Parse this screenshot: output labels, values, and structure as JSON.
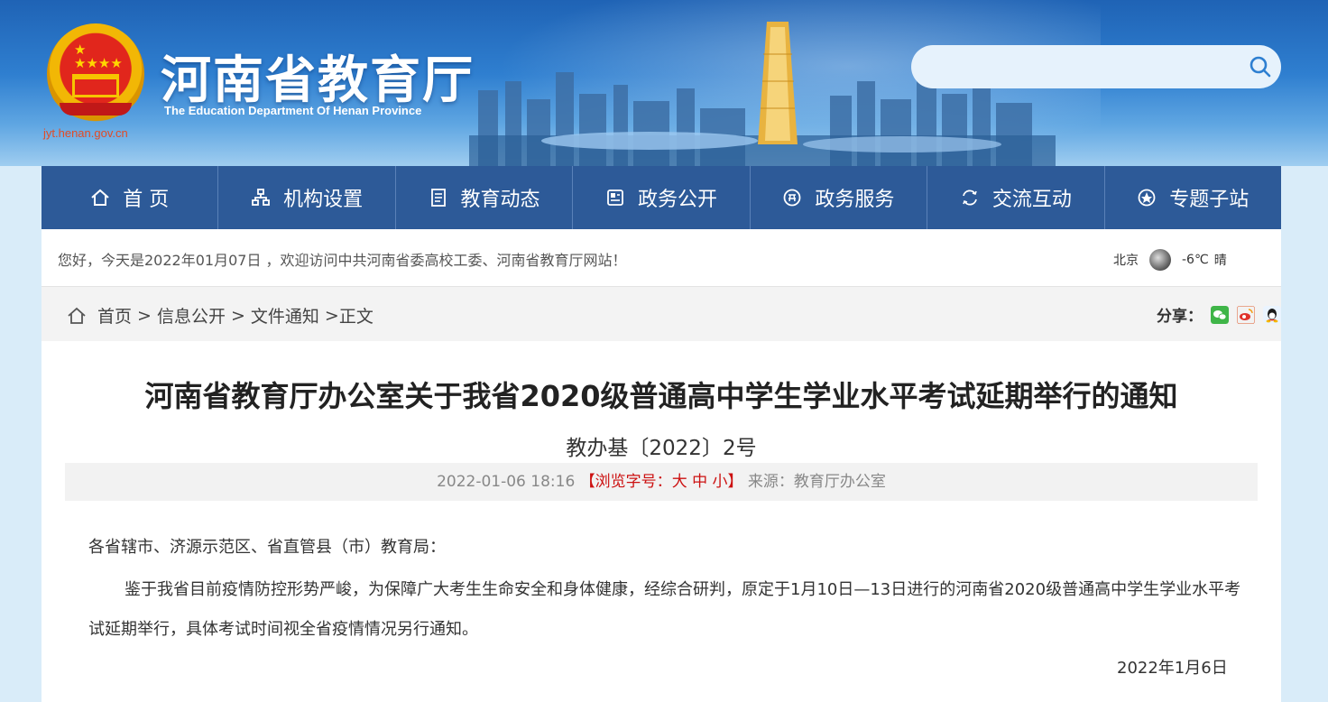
{
  "header": {
    "site_name": "河南省教育厅",
    "site_en": "The Education Department Of Henan Province",
    "site_url": "jyt.henan.gov.cn",
    "search_placeholder": ""
  },
  "nav": [
    {
      "label": "首 页",
      "icon": "home-icon"
    },
    {
      "label": "机构设置",
      "icon": "org-icon"
    },
    {
      "label": "教育动态",
      "icon": "news-icon"
    },
    {
      "label": "政务公开",
      "icon": "gov-open-icon"
    },
    {
      "label": "政务服务",
      "icon": "gov-service-icon"
    },
    {
      "label": "交流互动",
      "icon": "interaction-icon"
    },
    {
      "label": "专题子站",
      "icon": "topic-icon"
    }
  ],
  "info": {
    "welcome": "您好，今天是2022年01月07日 ，欢迎访问中共河南省委高校工委、河南省教育厅网站！",
    "city": "北京",
    "temp": "-6℃",
    "weather": "晴"
  },
  "breadcrumb": {
    "items": [
      "首页",
      "信息公开",
      "文件通知"
    ],
    "current": "正文",
    "share_label": "分享："
  },
  "article": {
    "title": "河南省教育厅办公室关于我省2020级普通高中学生学业水平考试延期举行的通知",
    "doc_no": "教办基〔2022〕2号",
    "datetime": "2022-01-06 18:16",
    "font_open": "【浏览字号：",
    "font_large": "大",
    "font_medium": "中",
    "font_small": "小",
    "font_close": "】",
    "source": "来源：教育厅办公室",
    "greeting": "各省辖市、济源示范区、省直管县（市）教育局：",
    "body": "鉴于我省目前疫情防控形势严峻，为保障广大考生生命安全和身体健康，经综合研判，原定于1月10日—13日进行的河南省2020级普通高中学生学业水平考试延期举行，具体考试时间视全省疫情情况另行通知。",
    "date": "2022年1月6日"
  },
  "colors": {
    "nav_bg": "#2d5a98",
    "accent_red": "#cc1111"
  }
}
